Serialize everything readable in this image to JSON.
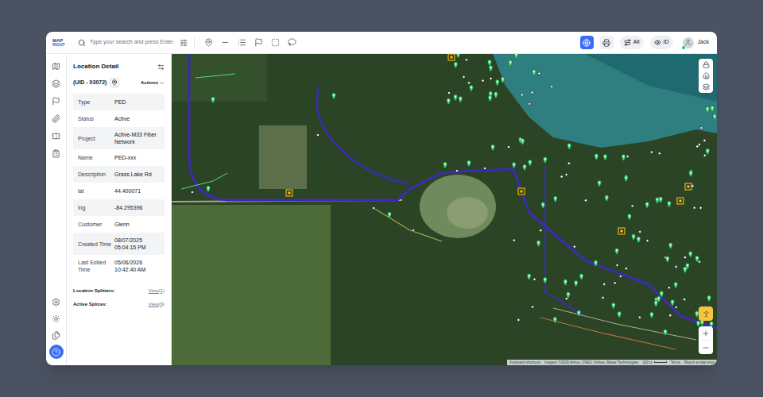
{
  "logo": {
    "top": "MAP",
    "bottom": "RIGHT"
  },
  "toolbar": {
    "search_placeholder": "Type your search and press Enter",
    "map_view_selected": true,
    "print_selected": false,
    "pills": [
      {
        "label": "All"
      },
      {
        "label": "ID"
      }
    ],
    "user": {
      "name": "Jack",
      "online": true
    }
  },
  "rail": {
    "top": [
      {
        "selected": false
      },
      {
        "selected": false
      },
      {
        "selected": false
      },
      {
        "selected": false
      },
      {
        "selected": false
      },
      {
        "selected": false
      }
    ],
    "bottom": [
      {
        "selected": false
      },
      {
        "selected": false
      },
      {
        "selected": false
      },
      {
        "selected": true
      }
    ]
  },
  "detail": {
    "title": "Location Detail",
    "uid": "(UID - 03072)",
    "actions": "Actions",
    "fields": [
      {
        "label": "Type",
        "value": "PED"
      },
      {
        "label": "Status",
        "value": "Active"
      },
      {
        "label": "Project",
        "value": "Active-M33 Fiber Network"
      },
      {
        "label": "Name",
        "value": "PED-xxx"
      },
      {
        "label": "Description",
        "value": "Grass Lake Rd"
      },
      {
        "label": "lat",
        "value": "44.400071"
      },
      {
        "label": "lng",
        "value": "-84.295396"
      },
      {
        "label": "Customer",
        "value": "Glenn"
      },
      {
        "label": "Created Time",
        "value": "08/07/2025 05:04:15 PM"
      },
      {
        "label": "Last Edited Time",
        "value": "05/06/2026 10:42:40 AM"
      }
    ],
    "links": [
      {
        "label": "Location Splitters:",
        "action": "View(1)"
      },
      {
        "label": "Active Splices:",
        "action": "View(9)"
      }
    ]
  },
  "map": {
    "attribution": [
      "Keyboard shortcuts",
      "Imagery ©2026 Airbus, CNES / Airbus, Maxar Technologies",
      "100 m",
      "Terms",
      "Report a map error"
    ]
  }
}
